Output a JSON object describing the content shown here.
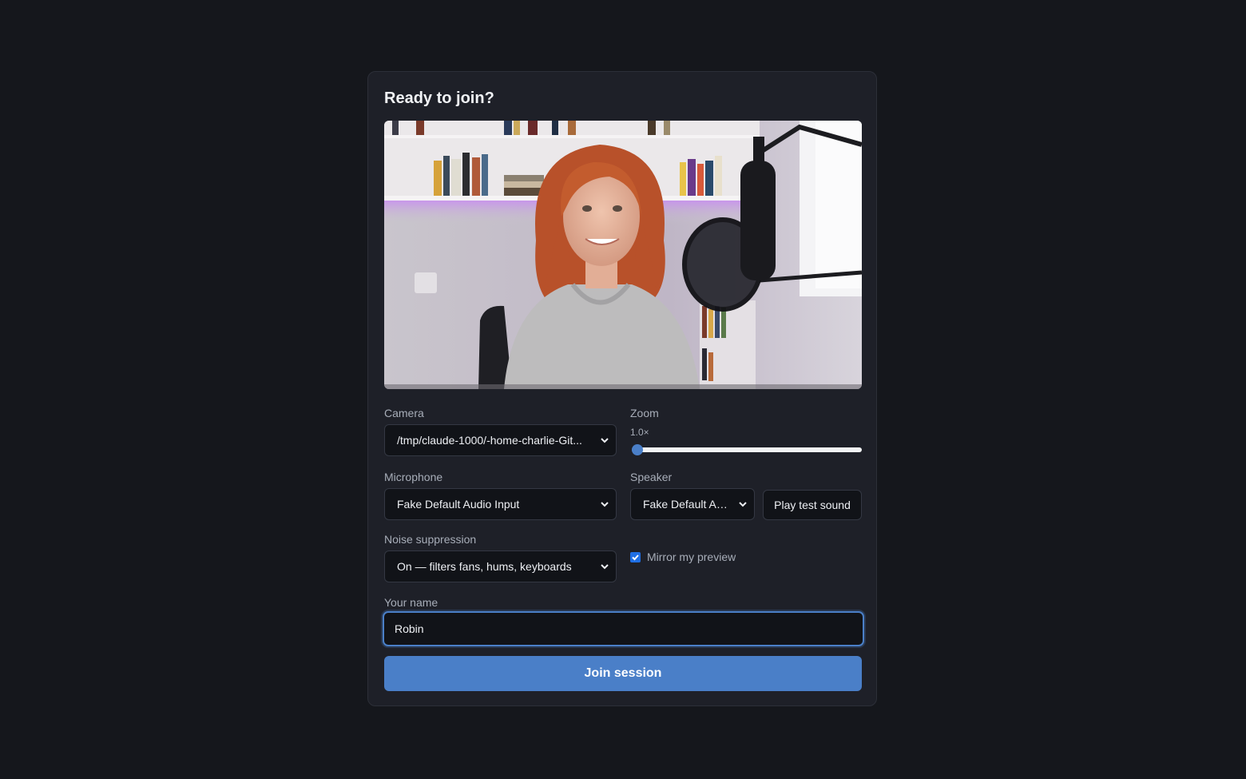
{
  "dialog": {
    "title": "Ready to join?"
  },
  "camera": {
    "label": "Camera",
    "selected": "/tmp/claude-1000/-home-charlie-Git..."
  },
  "zoom": {
    "label": "Zoom",
    "value_text": "1.0×",
    "level": 0.0
  },
  "microphone": {
    "label": "Microphone",
    "selected": "Fake Default Audio Input"
  },
  "speaker": {
    "label": "Speaker",
    "selected": "Fake Default Au...",
    "test_button": "Play test sound"
  },
  "noise_suppression": {
    "label": "Noise suppression",
    "selected": "On — filters fans, hums, keyboards"
  },
  "mirror": {
    "label": "Mirror my preview",
    "checked": true
  },
  "name": {
    "label": "Your name",
    "value": "Robin"
  },
  "join_button": "Join session",
  "colors": {
    "accent": "#4a7fc8",
    "background": "#15171c",
    "card": "#1e2028"
  }
}
